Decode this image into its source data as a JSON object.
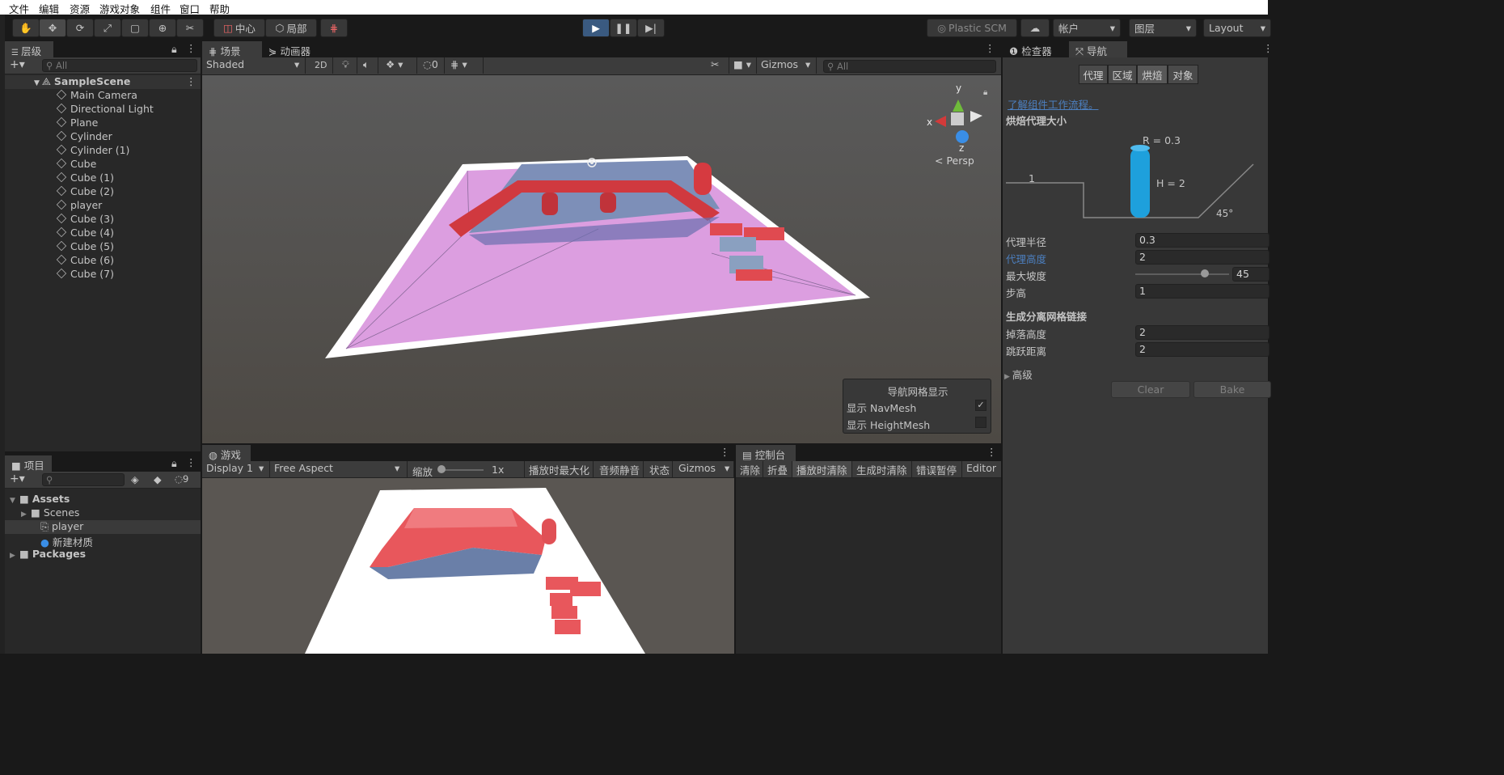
{
  "menubar": [
    "文件",
    "编辑",
    "资源",
    "游戏对象",
    "组件",
    "窗口",
    "帮助"
  ],
  "toolbar": {
    "center_label": "中心",
    "local_label": "局部",
    "plastic_label": "Plastic SCM",
    "account_label": "帐户",
    "layers_label": "图层",
    "layout_label": "Layout"
  },
  "hierarchy": {
    "tab": "层级",
    "search_placeholder": "All",
    "scene": "SampleScene",
    "items": [
      "Main Camera",
      "Directional Light",
      "Plane",
      "Cylinder",
      "Cylinder (1)",
      "Cube",
      "Cube (1)",
      "Cube (2)",
      "player",
      "Cube (3)",
      "Cube (4)",
      "Cube (5)",
      "Cube (6)",
      "Cube (7)"
    ]
  },
  "scene": {
    "tabs": [
      "场景",
      "动画器"
    ],
    "shading": "Shaded",
    "two_d": "2D",
    "hidden_count": "0",
    "gizmos": "Gizmos",
    "search_placeholder": "All",
    "persp_label": "< Persp",
    "axis_x": "x",
    "axis_y": "y",
    "axis_z": "z",
    "overlay": {
      "title": "导航网格显示",
      "show_navmesh": "显示 NavMesh",
      "show_heightmesh": "显示 HeightMesh",
      "navmesh_checked": true,
      "heightmesh_checked": false
    }
  },
  "project": {
    "tab": "项目",
    "hidden_count": "9",
    "items": [
      {
        "label": "Assets",
        "bold": true
      },
      {
        "label": "Scenes",
        "bold": false
      },
      {
        "label": "player",
        "bold": false
      },
      {
        "label": "新建材质",
        "bold": false
      },
      {
        "label": "Packages",
        "bold": true
      }
    ]
  },
  "game": {
    "tab": "游戏",
    "display": "Display 1",
    "aspect": "Free Aspect",
    "scale_label": "缩放",
    "scale_value": "1x",
    "maximize": "播放时最大化",
    "mute": "音频静音",
    "stats": "状态",
    "gizmos": "Gizmos"
  },
  "console": {
    "tab": "控制台",
    "clear": "清除",
    "collapse": "折叠",
    "clear_on_play": "播放时清除",
    "clear_on_build": "生成时清除",
    "error_pause": "错误暂停",
    "editor": "Editor"
  },
  "inspector": {
    "tabs": [
      "检查器",
      "导航"
    ],
    "segments": [
      "代理",
      "区域",
      "烘焙",
      "对象"
    ],
    "selected_segment": "烘焙",
    "learn_link": "了解组件工作流程。",
    "bake_size_title": "烘焙代理大小",
    "diagram": {
      "r_label": "R = 0.3",
      "h_label": "H = 2",
      "step_label": "1",
      "slope_label": "45°"
    },
    "fields": [
      {
        "label": "代理半径",
        "value": "0.3"
      },
      {
        "label": "代理高度",
        "value": "2"
      },
      {
        "label": "最大坡度",
        "value": "45"
      },
      {
        "label": "步高",
        "value": "1"
      }
    ],
    "max_slope_fraction": 0.5,
    "offmesh_title": "生成分离网格链接",
    "offmesh_fields": [
      {
        "label": "掉落高度",
        "value": "2"
      },
      {
        "label": "跳跃距离",
        "value": "2"
      }
    ],
    "advanced": "高级",
    "clear_button": "Clear",
    "bake_button": "Bake"
  },
  "colors": {
    "accent_blue": "#4c7fbf",
    "navmesh": "#e6a8e6",
    "agent_cylinder": "#1ea0dc",
    "red_object": "#e84a52"
  }
}
